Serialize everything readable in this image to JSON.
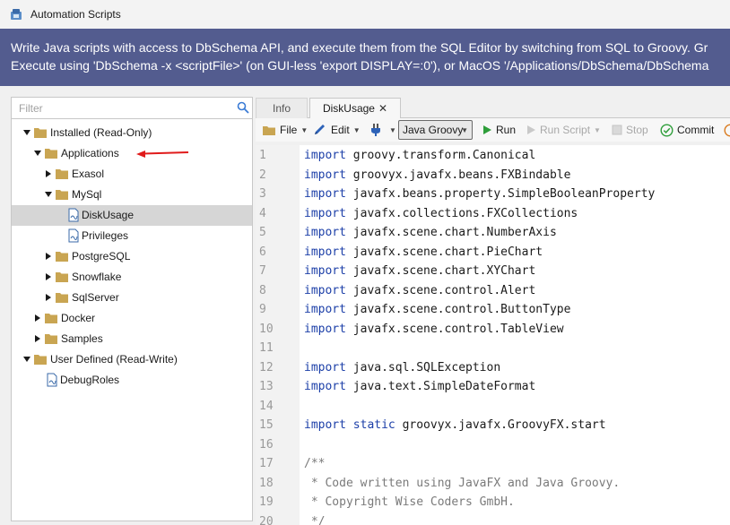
{
  "window": {
    "title": "Automation Scripts"
  },
  "banner": {
    "line1": "Write Java scripts with access to DbSchema API, and execute them from the SQL Editor by switching from SQL to Groovy. Gr",
    "line2": "Execute using 'DbSchema -x <scriptFile>' (on GUI-less 'export DISPLAY=:0'), or MacOS '/Applications/DbSchema/DbSchema"
  },
  "filter": {
    "placeholder": "Filter",
    "value": ""
  },
  "tree": [
    {
      "label": "Installed (Read-Only)",
      "level": 0,
      "expanded": true,
      "type": "folder"
    },
    {
      "label": "Applications",
      "level": 1,
      "expanded": true,
      "type": "folder"
    },
    {
      "label": "Exasol",
      "level": 2,
      "expanded": false,
      "type": "folder"
    },
    {
      "label": "MySql",
      "level": 2,
      "expanded": true,
      "type": "folder"
    },
    {
      "label": "DiskUsage",
      "level": 3,
      "type": "file",
      "selected": true
    },
    {
      "label": "Privileges",
      "level": 3,
      "type": "file"
    },
    {
      "label": "PostgreSQL",
      "level": 2,
      "expanded": false,
      "type": "folder"
    },
    {
      "label": "Snowflake",
      "level": 2,
      "expanded": false,
      "type": "folder"
    },
    {
      "label": "SqlServer",
      "level": 2,
      "expanded": false,
      "type": "folder"
    },
    {
      "label": "Docker",
      "level": 1,
      "expanded": false,
      "type": "folder"
    },
    {
      "label": "Samples",
      "level": 1,
      "expanded": false,
      "type": "folder"
    },
    {
      "label": "User Defined (Read-Write)",
      "level": 0,
      "expanded": true,
      "type": "folder"
    },
    {
      "label": "DebugRoles",
      "level": 1,
      "type": "file"
    }
  ],
  "tabs": {
    "info": "Info",
    "active": "DiskUsage"
  },
  "toolbar": {
    "file": "File",
    "edit": "Edit",
    "language": "Java Groovy",
    "run": "Run",
    "run_script": "Run Script",
    "stop": "Stop",
    "commit": "Commit"
  },
  "colors": {
    "banner": "#535c8f",
    "keyword": "#1c3fa8",
    "selection": "#d6d6d6",
    "folder": "#c9a552",
    "arrow": "#e01b1b"
  },
  "code_lines": [
    {
      "n": "1",
      "kw": "import",
      "rest": " groovy.transform.Canonical"
    },
    {
      "n": "2",
      "kw": "import",
      "rest": " groovyx.javafx.beans.FXBindable"
    },
    {
      "n": "3",
      "kw": "import",
      "rest": " javafx.beans.property.SimpleBooleanProperty"
    },
    {
      "n": "4",
      "kw": "import",
      "rest": " javafx.collections.FXCollections"
    },
    {
      "n": "5",
      "kw": "import",
      "rest": " javafx.scene.chart.NumberAxis"
    },
    {
      "n": "6",
      "kw": "import",
      "rest": " javafx.scene.chart.PieChart"
    },
    {
      "n": "7",
      "kw": "import",
      "rest": " javafx.scene.chart.XYChart"
    },
    {
      "n": "8",
      "kw": "import",
      "rest": " javafx.scene.control.Alert"
    },
    {
      "n": "9",
      "kw": "import",
      "rest": " javafx.scene.control.ButtonType"
    },
    {
      "n": "10",
      "kw": "import",
      "rest": " javafx.scene.control.TableView"
    },
    {
      "n": "11",
      "kw": "",
      "rest": ""
    },
    {
      "n": "12",
      "kw": "import",
      "rest": " java.sql.SQLException"
    },
    {
      "n": "13",
      "kw": "import",
      "rest": " java.text.SimpleDateFormat"
    },
    {
      "n": "14",
      "kw": "",
      "rest": ""
    },
    {
      "n": "15",
      "kw": "import static",
      "rest": " groovyx.javafx.GroovyFX.start"
    },
    {
      "n": "16",
      "kw": "",
      "rest": ""
    },
    {
      "n": "17",
      "kw": "",
      "cm": "/**"
    },
    {
      "n": "18",
      "kw": "",
      "cm": " * Code written using JavaFX and Java Groovy."
    },
    {
      "n": "19",
      "kw": "",
      "cm": " * Copyright Wise Coders GmbH."
    },
    {
      "n": "20",
      "kw": "",
      "cm": " */"
    }
  ]
}
